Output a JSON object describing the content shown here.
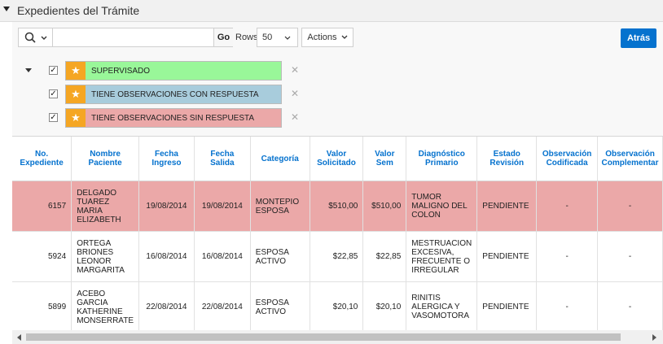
{
  "region": {
    "title": "Expedientes del Trámite"
  },
  "toolbar": {
    "search_value": "",
    "go_label": "Go",
    "rows_label": "Rows",
    "rows_value": "50",
    "actions_label": "Actions",
    "back_label": "Atrás"
  },
  "filters": [
    {
      "label": "SUPERVISADO",
      "color": "#99f799",
      "checked": true
    },
    {
      "label": "TIENE OBSERVACIONES CON RESPUESTA",
      "color": "#a8ccdc",
      "checked": true
    },
    {
      "label": "TIENE OBSERVACIONES SIN RESPUESTA",
      "color": "#eba8a8",
      "checked": true
    }
  ],
  "table": {
    "headers": [
      "No.\nExpediente",
      "Nombre\nPaciente",
      "Fecha\nIngreso",
      "Fecha\nSalida",
      "Categoría",
      "Valor\nSolicitado",
      "Valor\nSem",
      "Diagnóstico\nPrimario",
      "Estado\nRevisión",
      "Observación\nCodificada",
      "Observación\nComplementar"
    ],
    "rows": [
      [
        "6157",
        "DELGADO TUAREZ MARIA ELIZABETH",
        "19/08/2014",
        "19/08/2014",
        "MONTEPIO ESPOSA",
        "$510,00",
        "$510,00",
        "TUMOR MALIGNO DEL COLON",
        "PENDIENTE",
        "-",
        "-"
      ],
      [
        "5924",
        "ORTEGA BRIONES LEONOR MARGARITA",
        "16/08/2014",
        "16/08/2014",
        "ESPOSA ACTIVO",
        "$22,85",
        "$22,85",
        "MESTRUACION EXCESIVA, FRECUENTE O IRREGULAR",
        "PENDIENTE",
        "-",
        "-"
      ],
      [
        "5899",
        "ACEBO GARCIA KATHERINE MONSERRATE",
        "22/08/2014",
        "22/08/2014",
        "ESPOSA ACTIVO",
        "$20,10",
        "$20,10",
        "RINITIS ALERGICA Y VASOMOTORA",
        "PENDIENTE",
        "-",
        "-"
      ]
    ]
  },
  "icons": {
    "star": "★",
    "remove": "✕",
    "check": "✓",
    "chevron": "▾"
  }
}
